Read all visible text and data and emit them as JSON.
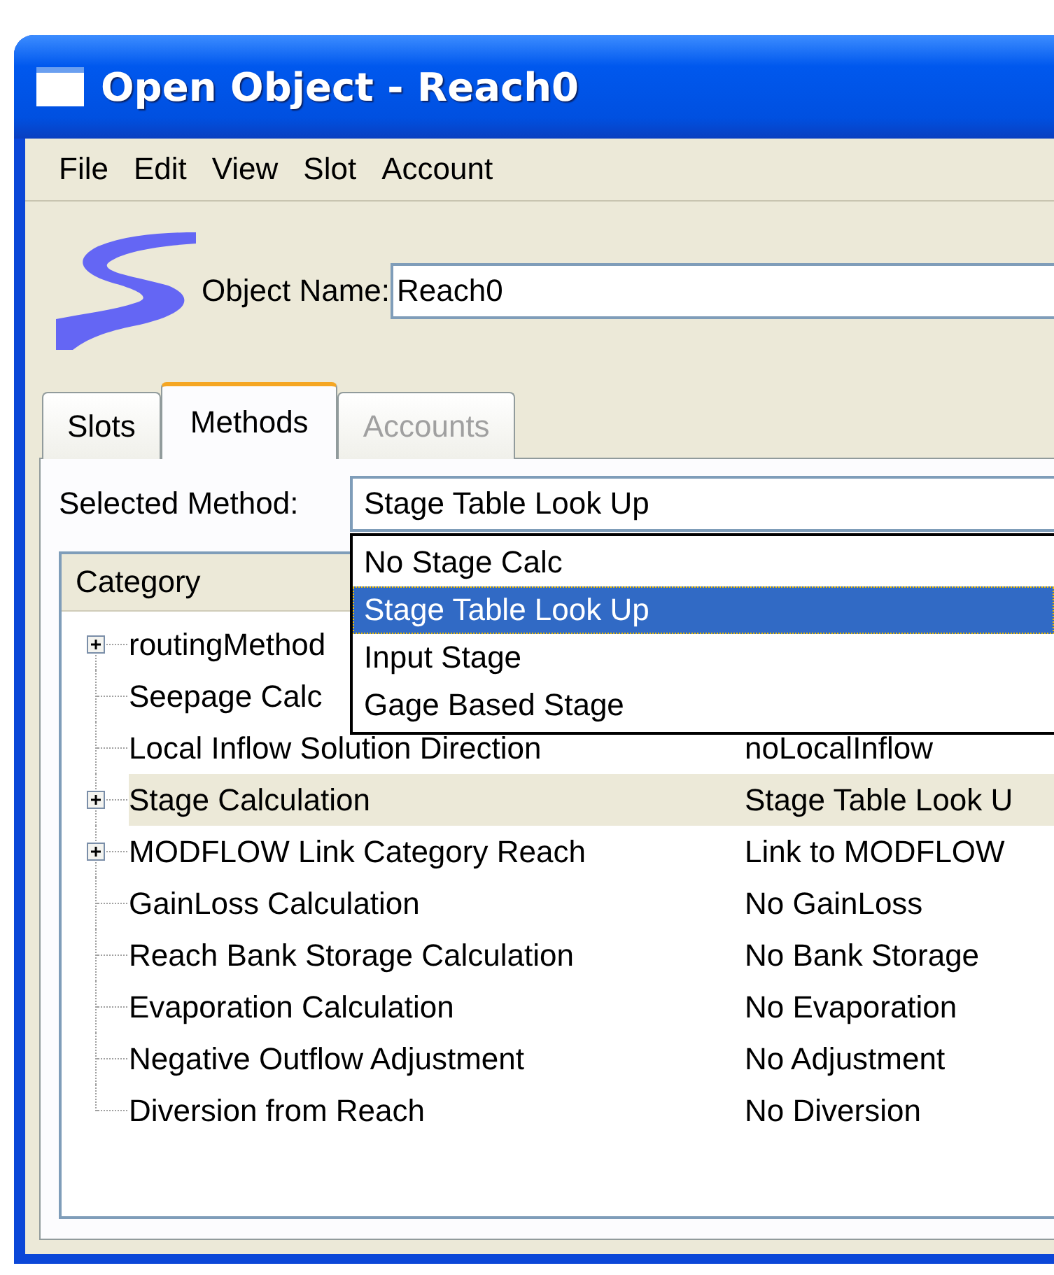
{
  "window": {
    "title": "Open Object - Reach0"
  },
  "menu": [
    "File",
    "Edit",
    "View",
    "Slot",
    "Account"
  ],
  "object_name": {
    "label": "Object Name:",
    "value": "Reach0"
  },
  "tabs": [
    {
      "label": "Slots",
      "selected": false,
      "disabled": false
    },
    {
      "label": "Methods",
      "selected": true,
      "disabled": false
    },
    {
      "label": "Accounts",
      "selected": false,
      "disabled": true
    }
  ],
  "selected_method": {
    "label": "Selected Method:",
    "value": "Stage Table Look Up"
  },
  "dropdown": [
    {
      "label": "No Stage Calc",
      "selected": false
    },
    {
      "label": "Stage Table Look Up",
      "selected": true
    },
    {
      "label": "Input Stage",
      "selected": false
    },
    {
      "label": "Gage Based Stage",
      "selected": false
    }
  ],
  "tree": {
    "columns": [
      "Category"
    ],
    "rows": [
      {
        "kind": "group",
        "category": "routingMethod",
        "selected": false
      },
      {
        "kind": "leaf",
        "category": "Seepage Calc",
        "selected": false
      },
      {
        "kind": "leaf",
        "category": "Local Inflow Solution Direction",
        "method": "noLocalInflow",
        "selected": false
      },
      {
        "kind": "group",
        "category": "Stage Calculation",
        "method": "Stage Table Look U",
        "selected": true
      },
      {
        "kind": "group",
        "category": "MODFLOW Link Category Reach",
        "method": "Link to MODFLOW",
        "selected": false
      },
      {
        "kind": "leaf",
        "category": "GainLoss Calculation",
        "method": "No GainLoss",
        "selected": false
      },
      {
        "kind": "leaf",
        "category": "Reach Bank Storage Calculation",
        "method": "No Bank Storage",
        "selected": false
      },
      {
        "kind": "leaf",
        "category": "Evaporation Calculation",
        "method": "No Evaporation",
        "selected": false
      },
      {
        "kind": "leaf",
        "category": "Negative Outflow Adjustment",
        "method": "No Adjustment",
        "selected": false
      },
      {
        "kind": "leaf",
        "category": "Diversion from Reach",
        "method": "No Diversion",
        "selected": false
      }
    ]
  }
}
